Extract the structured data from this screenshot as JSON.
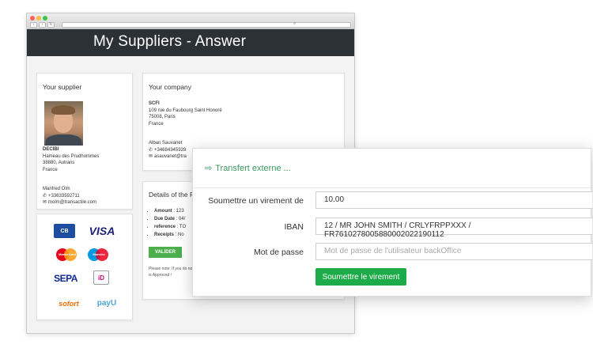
{
  "window": {
    "search_glyph": "⌕"
  },
  "page": {
    "title": "My Suppliers - Answer"
  },
  "supplier": {
    "heading": "Your supplier",
    "name": "DECIBI",
    "address_lines": [
      "Hameau des Prudhommes",
      "38880, Autrans",
      "France"
    ],
    "contact_name": "Manfred Olm",
    "phone": "+33633592711",
    "email": "molm@transactile.com"
  },
  "payment_methods": [
    "CB",
    "VISA",
    "MasterCard",
    "Maestro",
    "SEPA",
    "iD",
    "sofort",
    "payU"
  ],
  "company": {
    "heading": "Your company",
    "name": "SCFI",
    "address_lines": [
      "109 rue du Faubourg Saint Honoré",
      "75008, Paris",
      "France"
    ],
    "contact_name": "Alban Sauvanet",
    "phone": "+34684345939",
    "email": "asauvanet@tra"
  },
  "details": {
    "heading": "Details of the F",
    "items": [
      {
        "label": "Amount",
        "value": ": 123"
      },
      {
        "label": "Due Date",
        "value": ": 04/"
      },
      {
        "label": "reference",
        "value": ": TO"
      },
      {
        "label": "Receipts",
        "value": ": No"
      }
    ],
    "button": "VALIDER",
    "note_lines": [
      "Please note: If you do no",
      "is Approved !"
    ]
  },
  "transfer": {
    "title": "Transfert externe ...",
    "amount_label": "Soumettre un virement de",
    "amount_value": "10.00",
    "iban_label": "IBAN",
    "iban_value": "12 / MR JOHN SMITH / CRLYFRPPXXX / FR7610278005880002022190112",
    "password_label": "Mot de passe",
    "password_placeholder": "Mot de passe de l'utilisateur backOffice",
    "submit_label": "Soumettre le virement"
  },
  "colors": {
    "accent_green": "#1daa48",
    "title_green": "#3c9a5f",
    "header_dark": "#2b3134",
    "valider_green": "#4cae4c"
  }
}
